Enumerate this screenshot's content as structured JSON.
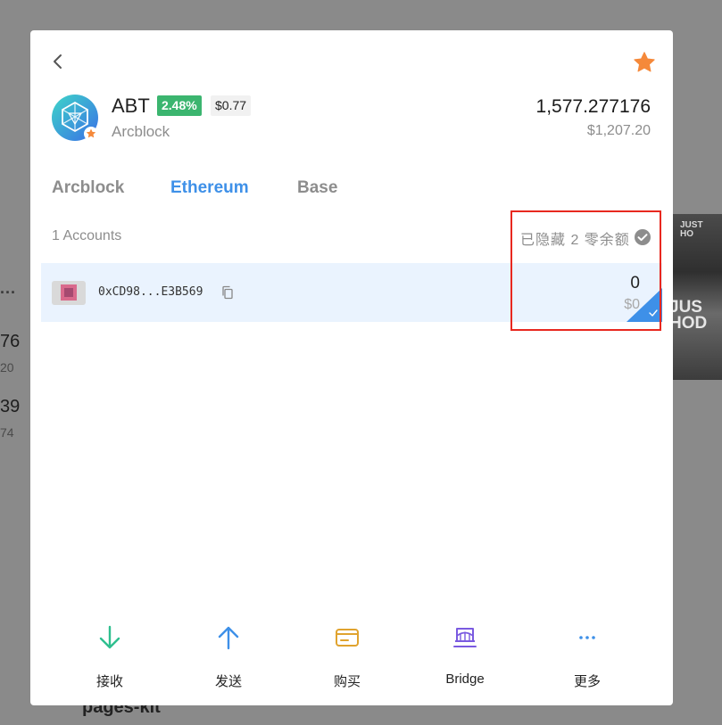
{
  "background": {
    "dots": "...",
    "values": [
      {
        "main": "76",
        "sub": "20"
      },
      {
        "main": "39",
        "sub": "74"
      }
    ],
    "footer_text": "pages-kit",
    "image_text_top": "JUST\nHO",
    "image_text_mid": "JUS\nHOD"
  },
  "token": {
    "symbol": "ABT",
    "change": "2.48%",
    "price": "$0.77",
    "name": "Arcblock",
    "balance": "1,577.277176",
    "balance_usd": "$1,207.20"
  },
  "tabs": [
    {
      "label": "Arcblock",
      "active": false
    },
    {
      "label": "Ethereum",
      "active": true
    },
    {
      "label": "Base",
      "active": false
    }
  ],
  "accounts": {
    "count_label": "1 Accounts",
    "hidden_label": "已隐藏 2 零余额",
    "items": [
      {
        "address": "0xCD98...E3B569",
        "balance": "0",
        "balance_usd": "$0"
      }
    ]
  },
  "actions": [
    {
      "label": "接收",
      "icon": "arrow-down-icon",
      "color": "#2fbf8f"
    },
    {
      "label": "发送",
      "icon": "arrow-up-icon",
      "color": "#3e90e8"
    },
    {
      "label": "购买",
      "icon": "card-icon",
      "color": "#e0a32e"
    },
    {
      "label": "Bridge",
      "icon": "bridge-icon",
      "color": "#7a5ae0"
    },
    {
      "label": "更多",
      "icon": "more-icon",
      "color": "#3e90e8"
    }
  ],
  "colors": {
    "accent": "#3e90e8",
    "positive": "#3bb56f",
    "favorite": "#f5893a",
    "selected_row": "#eaf3fe",
    "highlight": "#e8281f"
  }
}
